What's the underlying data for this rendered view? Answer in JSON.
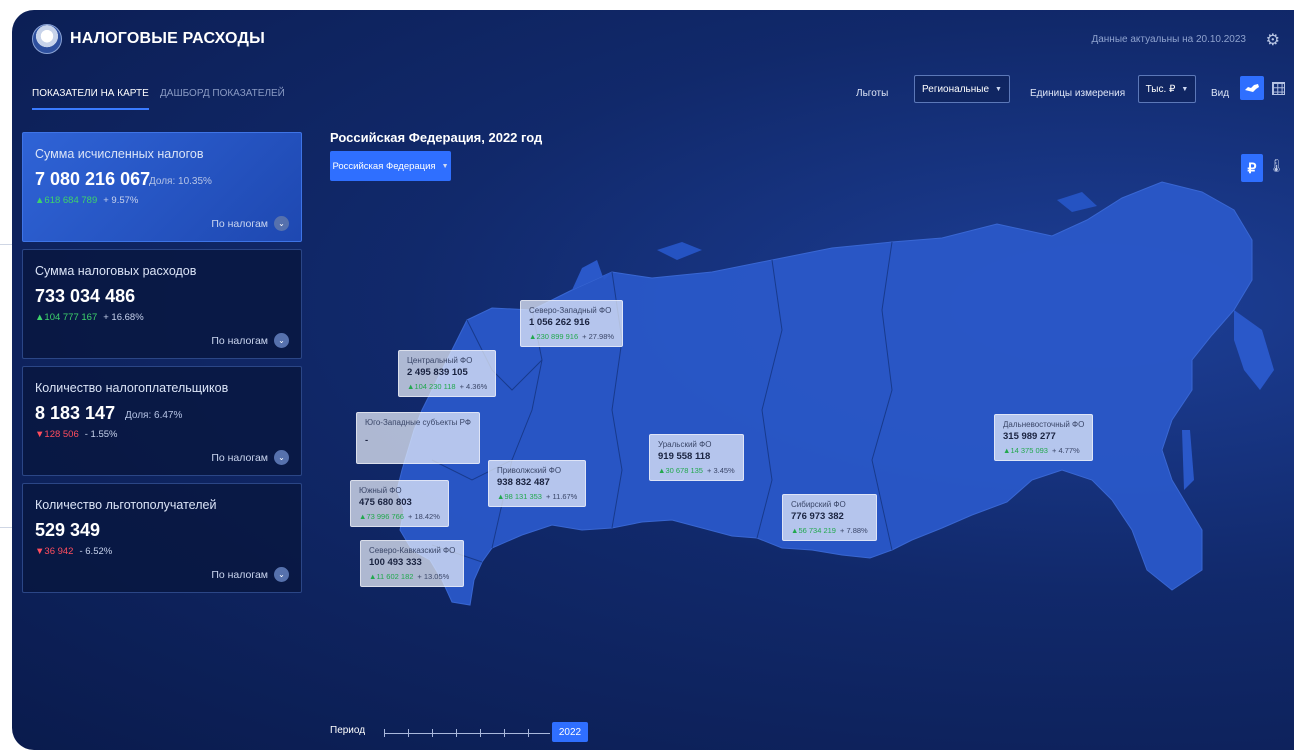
{
  "header": {
    "title": "НАЛОГОВЫЕ РАСХОДЫ",
    "actual_date": "Данные актуальны на 20.10.2023"
  },
  "tabs": [
    {
      "label": "ПОКАЗАТЕЛИ НА КАРТЕ",
      "active": true
    },
    {
      "label": "ДАШБОРД ПОКАЗАТЕЛЕЙ",
      "active": false
    }
  ],
  "controls": {
    "benefits_label": "Льготы",
    "benefits_value": "Региональные",
    "units_label": "Единицы измерения",
    "units_value": "Тыс. ₽",
    "view_label": "Вид"
  },
  "cards": [
    {
      "title": "Сумма исчисленных налогов",
      "value": "7 080 216 067",
      "share": "Доля: 10.35%",
      "delta": "618 684 789",
      "direction": "up",
      "pct": "+ 9.57%",
      "by": "По налогам"
    },
    {
      "title": "Сумма налоговых расходов",
      "value": "733 034 486",
      "share": "",
      "delta": "104 777 167",
      "direction": "up",
      "pct": "+ 16.68%",
      "by": "По налогам"
    },
    {
      "title": "Количество налогоплательщиков",
      "value": "8 183 147",
      "share": "Доля: 6.47%",
      "delta": "128 506",
      "direction": "down",
      "pct": "- 1.55%",
      "by": "По налогам"
    },
    {
      "title": "Количество льготополучателей",
      "value": "529 349",
      "share": "",
      "delta": "36 942",
      "direction": "down",
      "pct": "- 6.52%",
      "by": "По налогам"
    }
  ],
  "map": {
    "title": "Российская Федерация, 2022 год",
    "selector": "Российская Федерация",
    "currency_btn": "₽",
    "regions": {
      "nw": {
        "name": "Северо-Западный ФО",
        "value": "1 056 262 916",
        "delta": "230 899 916",
        "pct": "+ 27.98%"
      },
      "central": {
        "name": "Центральный ФО",
        "value": "2 495 839 105",
        "delta": "104 230 118",
        "pct": "+ 4.36%"
      },
      "sw": {
        "name": "Юго-Западные субъекты РФ",
        "value": "-"
      },
      "volga": {
        "name": "Приволжский ФО",
        "value": "938 832 487",
        "delta": "98 131 353",
        "pct": "+ 11.67%"
      },
      "ural": {
        "name": "Уральский ФО",
        "value": "919 558 118",
        "delta": "30 678 135",
        "pct": "+ 3.45%"
      },
      "south": {
        "name": "Южный ФО",
        "value": "475 680 803",
        "delta": "73 996 766",
        "pct": "+ 18.42%"
      },
      "ncaucasus": {
        "name": "Северо-Кавказский ФО",
        "value": "100 493 333",
        "delta": "11 602 182",
        "pct": "+ 13.05%"
      },
      "siberia": {
        "name": "Сибирский ФО",
        "value": "776 973 382",
        "delta": "56 734 219",
        "pct": "+ 7.88%"
      },
      "fareast": {
        "name": "Дальневосточный ФО",
        "value": "315 989 277",
        "delta": "14 375 093",
        "pct": "+ 4.77%"
      }
    }
  },
  "period": {
    "label": "Период",
    "year": "2022"
  }
}
